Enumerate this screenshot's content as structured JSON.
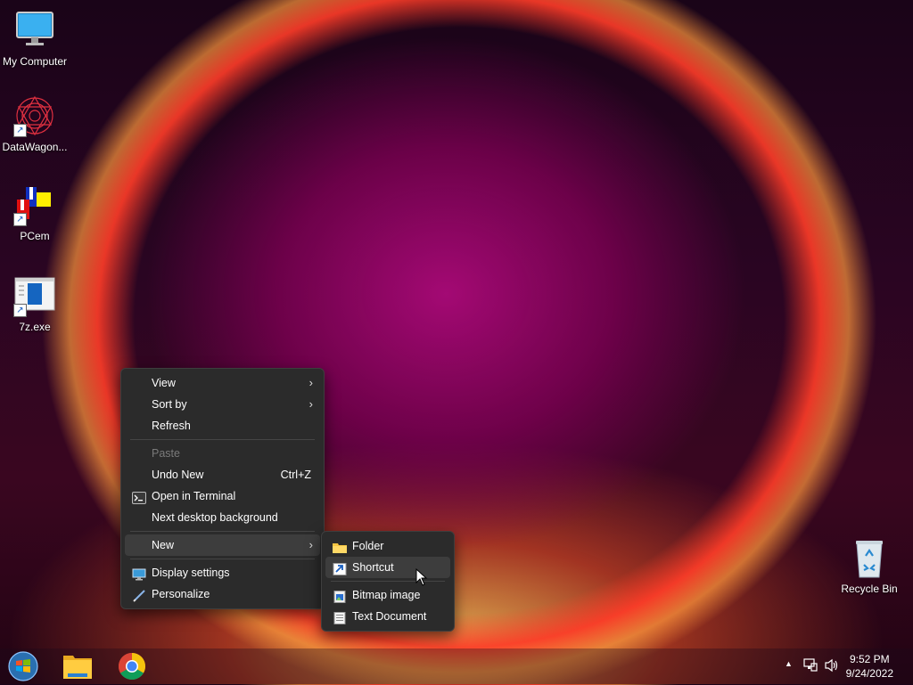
{
  "desktop": {
    "icons": [
      {
        "label": "My Computer",
        "icon": "monitor-icon"
      },
      {
        "label": "DataWagon...",
        "icon": "datawagon-icon"
      },
      {
        "label": "PCem",
        "icon": "pcem-icon"
      },
      {
        "label": "7z.exe",
        "icon": "exe-icon"
      },
      {
        "label": "Recycle Bin",
        "icon": "recycle-bin-icon"
      }
    ]
  },
  "context_menu": {
    "items": [
      {
        "label": "View",
        "submenu": true
      },
      {
        "label": "Sort by",
        "submenu": true
      },
      {
        "label": "Refresh"
      },
      {
        "label": "Paste",
        "disabled": true
      },
      {
        "label": "Undo New",
        "shortcut": "Ctrl+Z"
      },
      {
        "label": "Open in Terminal",
        "icon": "terminal-icon"
      },
      {
        "label": "Next desktop background"
      },
      {
        "label": "New",
        "submenu": true,
        "highlighted": true
      },
      {
        "label": "Display settings",
        "icon": "display-icon"
      },
      {
        "label": "Personalize",
        "icon": "brush-icon"
      }
    ]
  },
  "submenu_new": {
    "items": [
      {
        "label": "Folder",
        "icon": "folder-icon"
      },
      {
        "label": "Shortcut",
        "icon": "shortcut-icon",
        "highlighted": true
      },
      {
        "label": "Bitmap image",
        "icon": "bitmap-icon"
      },
      {
        "label": "Text Document",
        "icon": "text-document-icon"
      }
    ]
  },
  "taskbar": {
    "time": "9:52 PM",
    "date": "9/24/2022",
    "pinned": [
      "start-button",
      "file-explorer",
      "chrome"
    ]
  }
}
